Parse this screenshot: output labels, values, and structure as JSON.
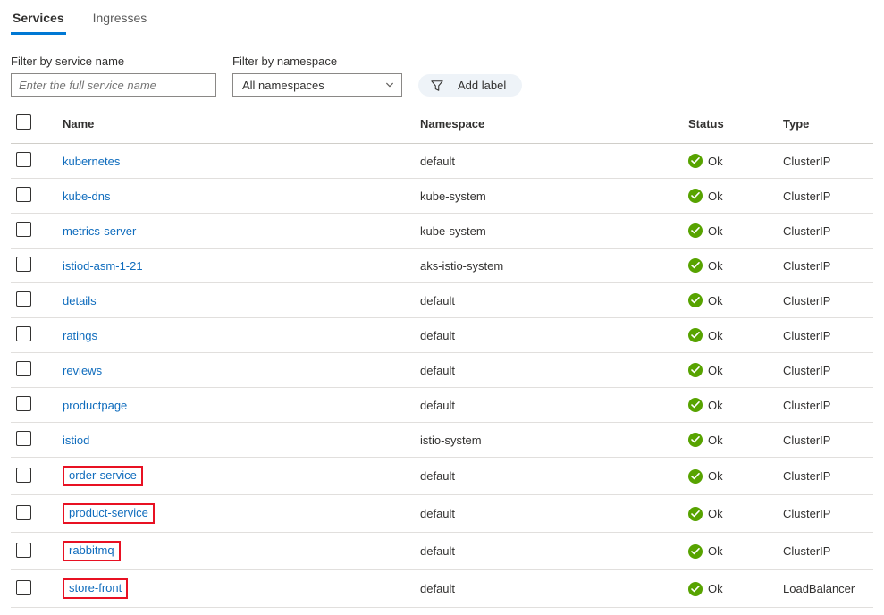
{
  "tabs": {
    "services": "Services",
    "ingresses": "Ingresses"
  },
  "filters": {
    "byNameLabel": "Filter by service name",
    "byNamePlaceholder": "Enter the full service name",
    "byNsLabel": "Filter by namespace",
    "nsSelected": "All namespaces",
    "addLabel": "Add label"
  },
  "columns": {
    "name": "Name",
    "namespace": "Namespace",
    "status": "Status",
    "type": "Type"
  },
  "statusOk": "Ok",
  "rows": [
    {
      "name": "kubernetes",
      "namespace": "default",
      "status": "ok",
      "type": "ClusterIP",
      "highlight": false
    },
    {
      "name": "kube-dns",
      "namespace": "kube-system",
      "status": "ok",
      "type": "ClusterIP",
      "highlight": false
    },
    {
      "name": "metrics-server",
      "namespace": "kube-system",
      "status": "ok",
      "type": "ClusterIP",
      "highlight": false
    },
    {
      "name": "istiod-asm-1-21",
      "namespace": "aks-istio-system",
      "status": "ok",
      "type": "ClusterIP",
      "highlight": false
    },
    {
      "name": "details",
      "namespace": "default",
      "status": "ok",
      "type": "ClusterIP",
      "highlight": false
    },
    {
      "name": "ratings",
      "namespace": "default",
      "status": "ok",
      "type": "ClusterIP",
      "highlight": false
    },
    {
      "name": "reviews",
      "namespace": "default",
      "status": "ok",
      "type": "ClusterIP",
      "highlight": false
    },
    {
      "name": "productpage",
      "namespace": "default",
      "status": "ok",
      "type": "ClusterIP",
      "highlight": false
    },
    {
      "name": "istiod",
      "namespace": "istio-system",
      "status": "ok",
      "type": "ClusterIP",
      "highlight": false
    },
    {
      "name": "order-service",
      "namespace": "default",
      "status": "ok",
      "type": "ClusterIP",
      "highlight": true
    },
    {
      "name": "product-service",
      "namespace": "default",
      "status": "ok",
      "type": "ClusterIP",
      "highlight": true
    },
    {
      "name": "rabbitmq",
      "namespace": "default",
      "status": "ok",
      "type": "ClusterIP",
      "highlight": true
    },
    {
      "name": "store-front",
      "namespace": "default",
      "status": "ok",
      "type": "LoadBalancer",
      "highlight": true
    }
  ]
}
